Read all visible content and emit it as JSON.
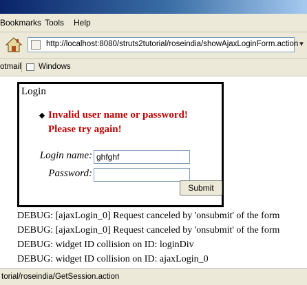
{
  "menu": {
    "bookmarks": "Bookmarks",
    "tools": "Tools",
    "help": "Help"
  },
  "nav": {
    "url": "http://localhost:8080/struts2tutorial/roseindia/showAjaxLoginForm.action"
  },
  "bookmarks_bar": {
    "item1": "otmail",
    "item2": "Windows"
  },
  "login": {
    "title": "Login",
    "error_line1": "Invalid user name or password!",
    "error_line2": "Please try again!",
    "login_name_label": "Login name:",
    "login_name_value": "ghfghf",
    "password_label": "Password:",
    "password_value": "",
    "submit_label": "Submit"
  },
  "debug": [
    "DEBUG: [ajaxLogin_0] Request canceled by 'onsubmit' of the form",
    "DEBUG: [ajaxLogin_0] Request canceled by 'onsubmit' of the form",
    "DEBUG: widget ID collision on ID: loginDiv",
    "DEBUG: widget ID collision on ID: ajaxLogin_0"
  ],
  "status": {
    "text": "torial/roseindia/GetSession.action"
  }
}
